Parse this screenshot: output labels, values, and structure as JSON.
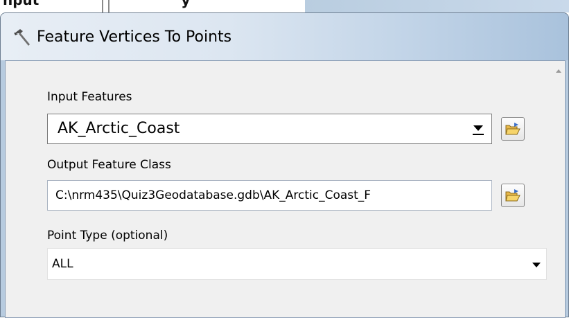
{
  "window": {
    "title": "Feature Vertices To Points",
    "icon": "hammer-icon"
  },
  "background_partial_text": {
    "left": "nput",
    "right": "y"
  },
  "form": {
    "input_features": {
      "label": "Input Features",
      "value": "AK_Arctic_Coast"
    },
    "output_feature_class": {
      "label": "Output Feature Class",
      "value": "C:\\nrm435\\Quiz3Geodatabase.gdb\\AK_Arctic_Coast_F"
    },
    "point_type": {
      "label": "Point Type (optional)",
      "value": "ALL"
    }
  },
  "icons": {
    "browse": "open-folder-icon",
    "dropdown": "chevron-down-icon"
  }
}
